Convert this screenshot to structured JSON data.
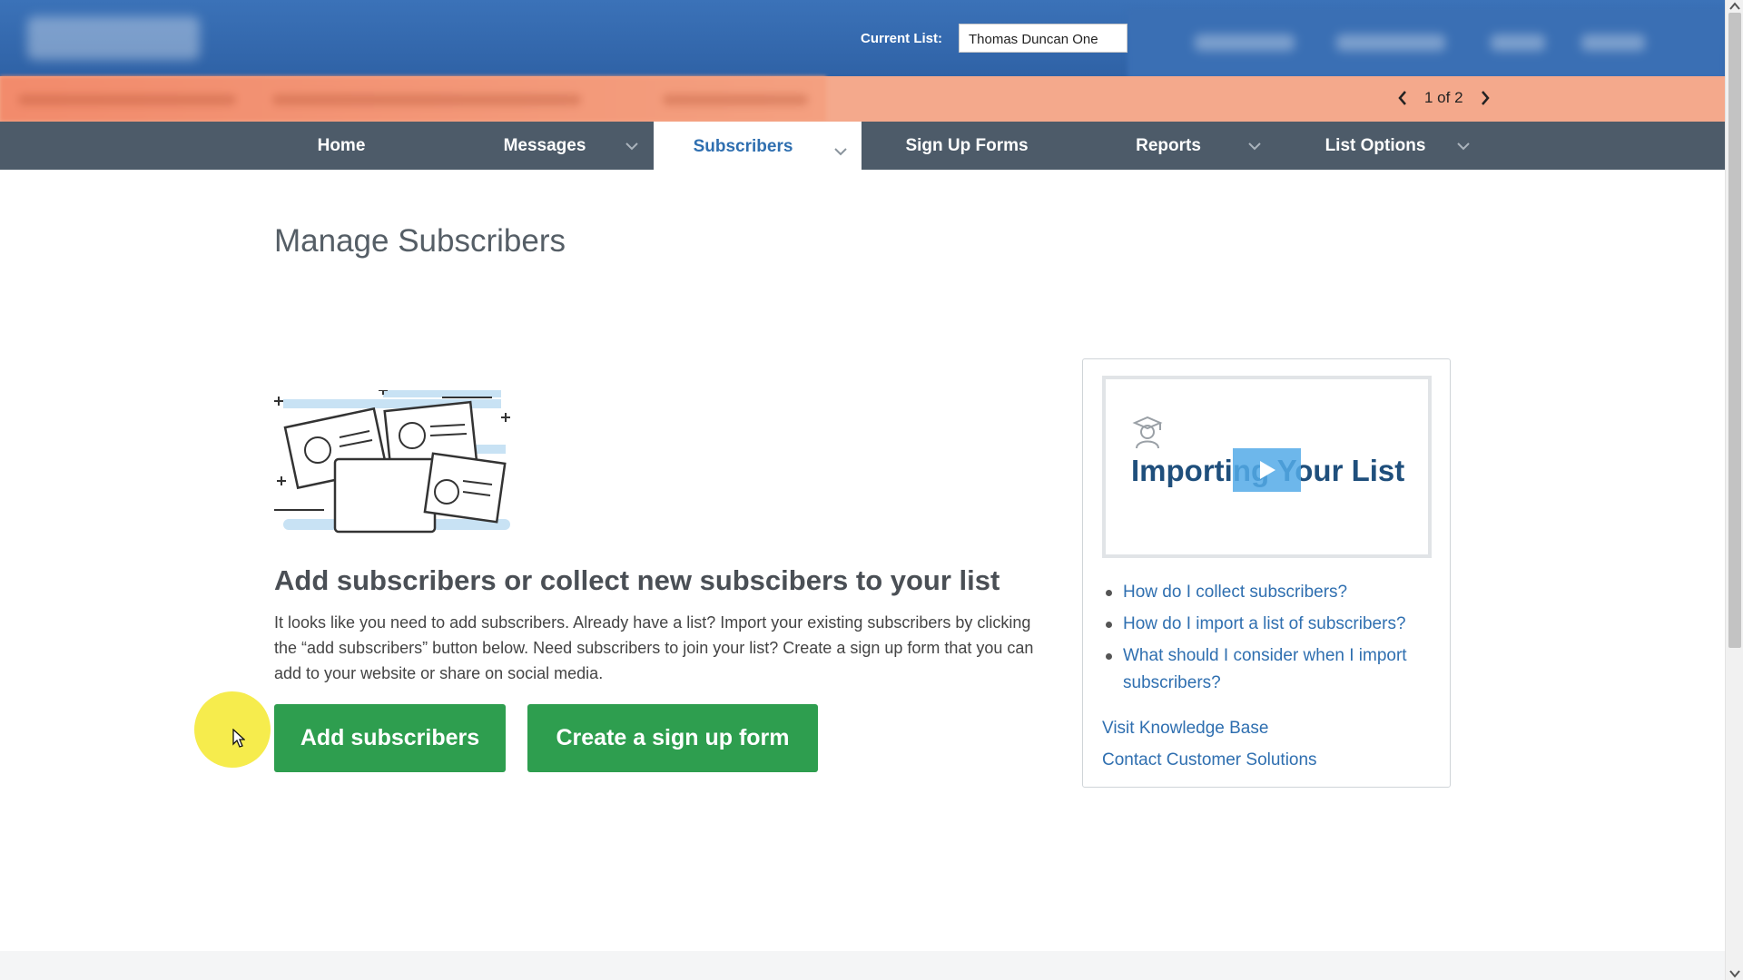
{
  "header": {
    "current_list_label": "Current List:",
    "current_list_value": "Thomas Duncan One"
  },
  "notice": {
    "pager_text": "1 of 2"
  },
  "nav": {
    "items": [
      {
        "label": "Home"
      },
      {
        "label": "Messages"
      },
      {
        "label": "Subscribers"
      },
      {
        "label": "Sign Up Forms"
      },
      {
        "label": "Reports"
      },
      {
        "label": "List Options"
      }
    ],
    "active": "Subscribers"
  },
  "main": {
    "title": "Manage Subscribers",
    "heading": "Add subscribers or collect new subscibers to your list",
    "description": "It looks like you need to add subscribers. Already have a list? Import your existing subscribers by clicking the “add subscribers” button below. Need subscribers to join your list? Create a sign up form that you can add to your website or share on social media.",
    "add_button": "Add subscribers",
    "form_button": "Create a sign up form"
  },
  "help": {
    "video_title": "Importing Your List",
    "links": [
      {
        "label": "How do I collect subscribers?"
      },
      {
        "label": "How do I import a list of subscribers?"
      },
      {
        "label": "What should I consider when I import subscribers?"
      }
    ],
    "knowledge_base": "Visit Knowledge Base",
    "contact": "Contact Customer Solutions"
  },
  "colors": {
    "header_blue": "#2f62a6",
    "notice_salmon": "#f4a98c",
    "nav_gray": "#4d5b69",
    "active_blue": "#2f6fb0",
    "button_green": "#2e9e4f",
    "cursor_highlight": "#f5ea3a"
  }
}
